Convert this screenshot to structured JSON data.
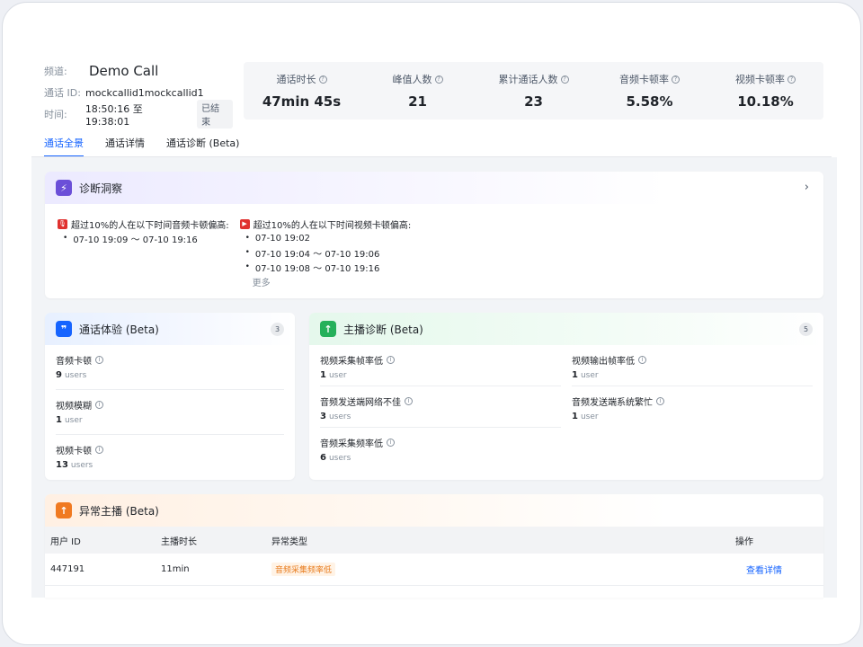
{
  "info": {
    "channel_label": "频道:",
    "channel_value": "Demo Call",
    "callid_label": "通话 ID:",
    "callid_value": "mockcallid1mockcallid1",
    "time_label": "时间:",
    "time_value": "18:50:16 至 19:38:01",
    "status": "已结束"
  },
  "stats": [
    {
      "label": "通话时长",
      "value": "47min 45s"
    },
    {
      "label": "峰值人数",
      "value": "21"
    },
    {
      "label": "累计通话人数",
      "value": "23"
    },
    {
      "label": "音频卡顿率",
      "value": "5.58%"
    },
    {
      "label": "视频卡顿率",
      "value": "10.18%"
    }
  ],
  "tabs": [
    "通话全景",
    "通话详情",
    "通话诊断 (Beta)"
  ],
  "insight": {
    "title": "诊断洞察",
    "audio_title": "超过10%的人在以下时间音频卡顿偏高:",
    "audio_items": [
      "07-10 19:09 ～ 07-10 19:16"
    ],
    "video_title": "超过10%的人在以下时间视频卡顿偏高:",
    "video_items": [
      "07-10 19:02",
      "07-10 19:04 ～ 07-10 19:06",
      "07-10 19:08 ～ 07-10 19:16"
    ],
    "more": "更多"
  },
  "experience": {
    "title": "通话体验 (Beta)",
    "count": "3",
    "items": [
      {
        "name": "音频卡顿",
        "value": "9",
        "unit": "users"
      },
      {
        "name": "视频模糊",
        "value": "1",
        "unit": "user"
      },
      {
        "name": "视频卡顿",
        "value": "13",
        "unit": "users"
      }
    ]
  },
  "host": {
    "title": "主播诊断 (Beta)",
    "count": "5",
    "left": [
      {
        "name": "视频采集帧率低",
        "value": "1",
        "unit": "user"
      },
      {
        "name": "音频发送端网络不佳",
        "value": "3",
        "unit": "users"
      },
      {
        "name": "音频采集频率低",
        "value": "6",
        "unit": "users"
      }
    ],
    "right": [
      {
        "name": "视频输出帧率低",
        "value": "1",
        "unit": "user"
      },
      {
        "name": "音频发送端系统繁忙",
        "value": "1",
        "unit": "user"
      }
    ]
  },
  "abnormal": {
    "title": "异常主播 (Beta)",
    "headers": [
      "用户 ID",
      "主播时长",
      "异常类型",
      "操作"
    ],
    "rows": [
      {
        "id": "447191",
        "duration": "11min",
        "type": "音频采集频率低",
        "action": "查看详情"
      }
    ]
  },
  "colors": {
    "accent": "#1664ff",
    "insight_icon": "#6b4fd8",
    "experience_icon": "#1664ff",
    "host_icon": "#25b05a",
    "abnormal_icon": "#f07a21",
    "alert_red": "#e0312f"
  }
}
